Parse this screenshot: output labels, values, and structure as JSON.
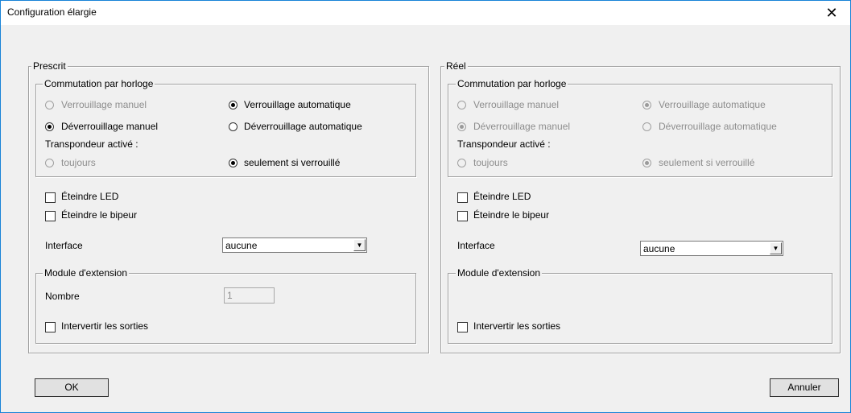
{
  "window": {
    "title": "Configuration élargie",
    "close_glyph": "✕"
  },
  "left": {
    "group_title": "Prescrit",
    "clock": {
      "group_title": "Commutation par horloge",
      "manual_lock": "Verrouillage manuel",
      "auto_lock": "Verrouillage automatique",
      "manual_unlock": "Déverrouillage manuel",
      "auto_unlock": "Déverrouillage automatique",
      "transponder_label": "Transpondeur activé :",
      "always": "toujours",
      "only_if_locked": "seulement si verrouillé"
    },
    "led_off": "Éteindre LED",
    "beeper_off": "Éteindre le bipeur",
    "interface_label": "Interface",
    "interface_value": "aucune",
    "extension": {
      "group_title": "Module d'extension",
      "count_label": "Nombre",
      "count_value": "1",
      "invert_outputs": "Intervertir les sorties"
    }
  },
  "right": {
    "group_title": "Réel",
    "clock": {
      "group_title": "Commutation par horloge",
      "manual_lock": "Verrouillage manuel",
      "auto_lock": "Verrouillage automatique",
      "manual_unlock": "Déverrouillage manuel",
      "auto_unlock": "Déverrouillage automatique",
      "transponder_label": "Transpondeur activé :",
      "always": "toujours",
      "only_if_locked": "seulement si verrouillé"
    },
    "led_off": "Éteindre LED",
    "beeper_off": "Éteindre le bipeur",
    "interface_label": "Interface",
    "interface_value": "aucune",
    "extension": {
      "group_title": "Module d'extension",
      "invert_outputs": "Intervertir les sorties"
    }
  },
  "footer": {
    "ok": "OK",
    "cancel": "Annuler"
  }
}
